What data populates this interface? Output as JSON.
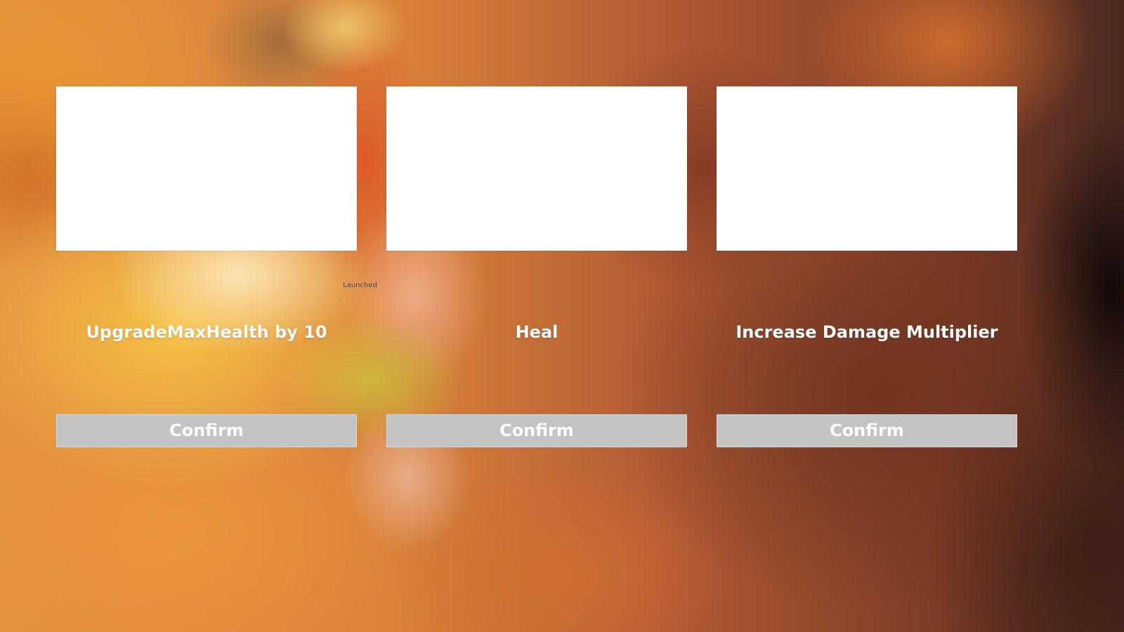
{
  "status": {
    "text": "Launched"
  },
  "options": [
    {
      "title": "UpgradeMaxHealth by 10",
      "button_label": "Confirm"
    },
    {
      "title": "Heal",
      "button_label": "Confirm"
    },
    {
      "title": "Increase Damage Multiplier",
      "button_label": "Confirm"
    }
  ],
  "colors": {
    "card_background": "#ffffff",
    "button_background": "#c4c4c4",
    "text": "#ffffff"
  }
}
